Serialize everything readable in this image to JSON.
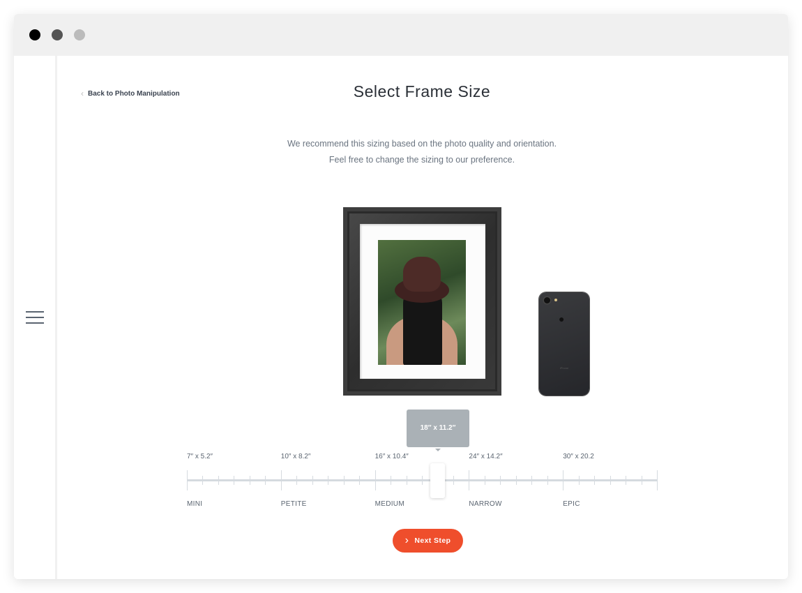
{
  "window": {
    "dots": [
      "#000000",
      "#555555",
      "#bbbbbb"
    ]
  },
  "sidebar": {
    "menu_icon": "hamburger-icon"
  },
  "header": {
    "back_label": "Back to Photo Manipulation",
    "title": "Select Frame Size"
  },
  "description": {
    "line1": "We recommend this sizing based on the photo quality and orientation.",
    "line2": "Feel free to change the sizing to our preference."
  },
  "preview": {
    "phone_label": "iPhone"
  },
  "slider": {
    "selected_label": "18″ x 11.2″",
    "position_fraction": 0.533,
    "stops": [
      {
        "size": "7″ x 5.2″",
        "name": "MINI"
      },
      {
        "size": "10″ x 8.2″",
        "name": "PETITE"
      },
      {
        "size": "16″ x 10.4″",
        "name": "MEDIUM"
      },
      {
        "size": "24″ x 14.2″",
        "name": "NARROW"
      },
      {
        "size": "30″ x 20.2",
        "name": "EPIC"
      }
    ]
  },
  "actions": {
    "next_label": "Next Step",
    "next_color": "#ef4e2c"
  }
}
